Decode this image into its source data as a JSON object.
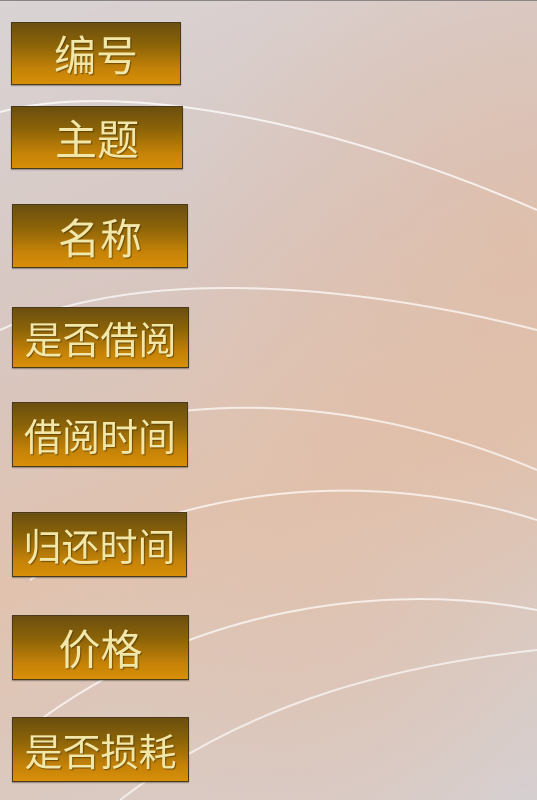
{
  "labels": [
    "编号",
    "主题",
    "名称",
    "是否借阅",
    "借阅时间",
    "归还时间",
    "价格",
    "是否损耗"
  ],
  "colors": {
    "label_gradient_top": "#6b4f10",
    "label_gradient_bottom": "#d88f08",
    "label_text": "#f1e7a8",
    "background": "#d8cfcc"
  }
}
